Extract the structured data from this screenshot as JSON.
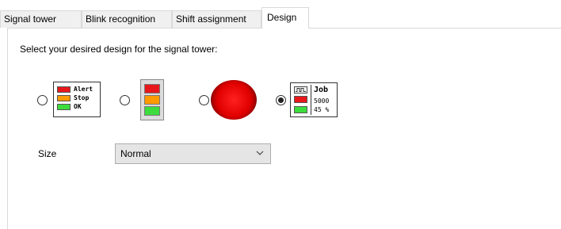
{
  "tabs": [
    {
      "label": "Signal tower",
      "active": false
    },
    {
      "label": "Blink recognition",
      "active": false
    },
    {
      "label": "Shift assignment",
      "active": false
    },
    {
      "label": "Design",
      "active": true
    }
  ],
  "design": {
    "description": "Select your desired design for the signal tower:",
    "options": [
      {
        "id": "labeled-tower",
        "selected": false,
        "labels": [
          "Alert",
          "Stop",
          "OK"
        ]
      },
      {
        "id": "stacked-tower",
        "selected": false
      },
      {
        "id": "single-lamp",
        "selected": false
      },
      {
        "id": "job-tower",
        "selected": true,
        "labels": [
          "Job",
          "5000",
          "45 %"
        ]
      }
    ],
    "size_label": "Size",
    "size_value": "Normal"
  },
  "colors": {
    "red": "#e8171b",
    "orange": "#ff9a00",
    "green": "#3ddc3d",
    "panel_border": "#d9d9d9"
  }
}
